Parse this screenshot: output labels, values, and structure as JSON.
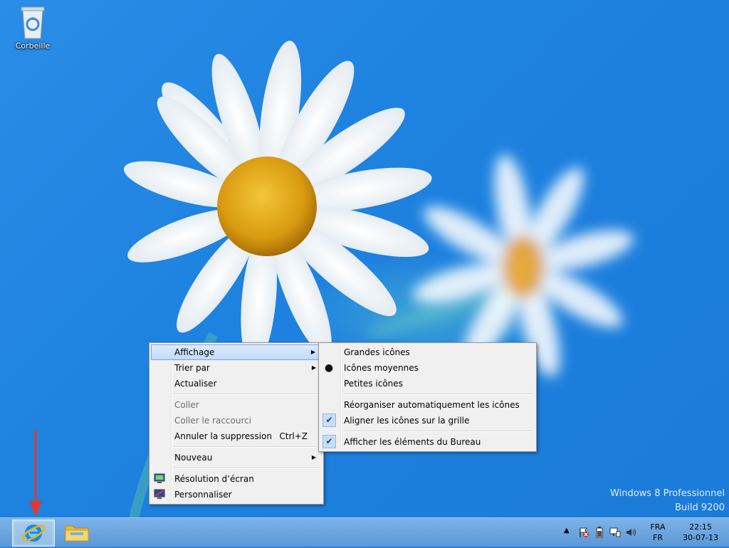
{
  "desktop": {
    "recycle_bin_label": "Corbeille",
    "watermark_line1": "Windows 8 Professionnel",
    "watermark_line2": "Build 9200"
  },
  "context_menu": {
    "items": [
      {
        "label": "Affichage",
        "submenu": true,
        "highlighted": true
      },
      {
        "label": "Trier par",
        "submenu": true
      },
      {
        "label": "Actualiser"
      },
      {
        "label": "Coller",
        "disabled": true
      },
      {
        "label": "Coller le raccourci",
        "disabled": true
      },
      {
        "label": "Annuler la suppression",
        "shortcut": "Ctrl+Z"
      },
      {
        "label": "Nouveau",
        "submenu": true
      },
      {
        "label": "Résolution d’écran",
        "icon": "display-icon"
      },
      {
        "label": "Personnaliser",
        "icon": "personalize-icon"
      }
    ]
  },
  "view_submenu": {
    "items": [
      {
        "label": "Grandes icônes"
      },
      {
        "label": "Icônes moyennes",
        "state": "radio-selected"
      },
      {
        "label": "Petites icônes"
      },
      {
        "label": "Réorganiser automatiquement les icônes"
      },
      {
        "label": "Aligner les icônes sur la grille",
        "state": "checked"
      },
      {
        "label": "Afficher les éléments du Bureau",
        "state": "checked"
      }
    ]
  },
  "taskbar": {
    "pinned": [
      {
        "name": "Internet Explorer",
        "icon": "ie-icon",
        "active": true
      },
      {
        "name": "Explorateur de fichiers",
        "icon": "folder-icon"
      }
    ],
    "tray": {
      "language_top": "FRA",
      "language_bottom": "FR",
      "time": "22:15",
      "date": "30-07-13"
    }
  },
  "colors": {
    "desktop_blue": "#1e82e0",
    "menu_bg": "#f0f0f0",
    "highlight": "#c1dbfc",
    "annotation_red": "#e03a2f"
  }
}
